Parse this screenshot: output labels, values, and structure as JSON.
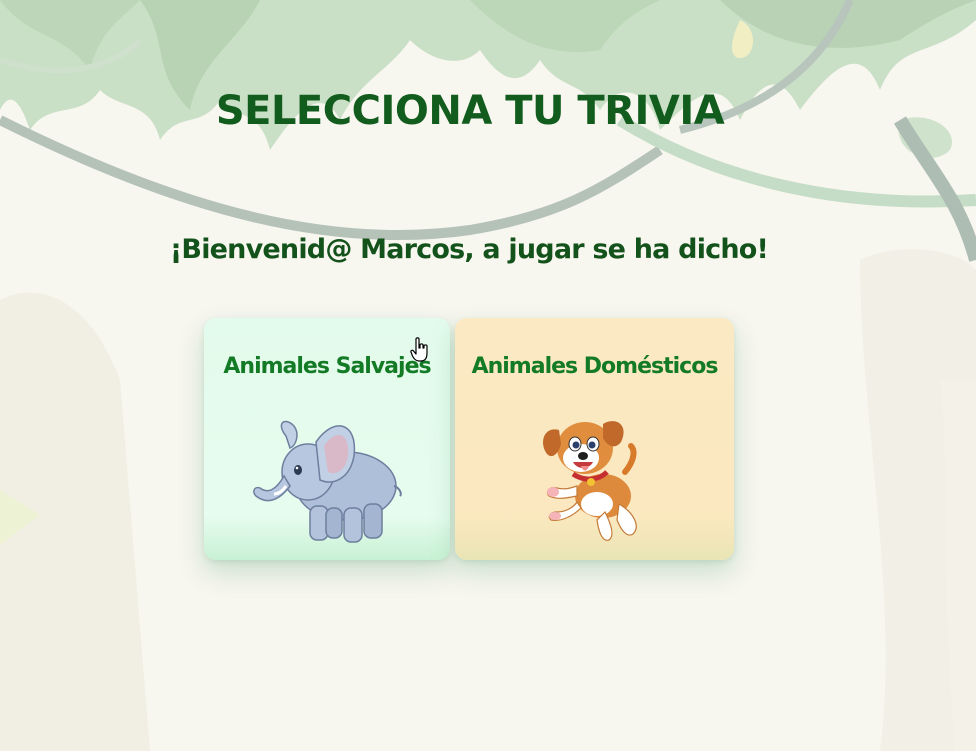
{
  "page": {
    "title": "SELECCIONA TU TRIVIA",
    "welcome": "¡Bienvenid@ Marcos, a jugar se ha dicho!"
  },
  "cards": [
    {
      "label": "Animales Salvajes",
      "image_icon": "elephant-icon",
      "background": "#e4fbec"
    },
    {
      "label": "Animales Domésticos",
      "image_icon": "puppy-icon",
      "background": "#fae9c2"
    }
  ],
  "colors": {
    "title": "#125c1d",
    "card_title": "#137a25",
    "jungle_leaves": "#c9dfc6",
    "vine": "#b9c7bf"
  }
}
